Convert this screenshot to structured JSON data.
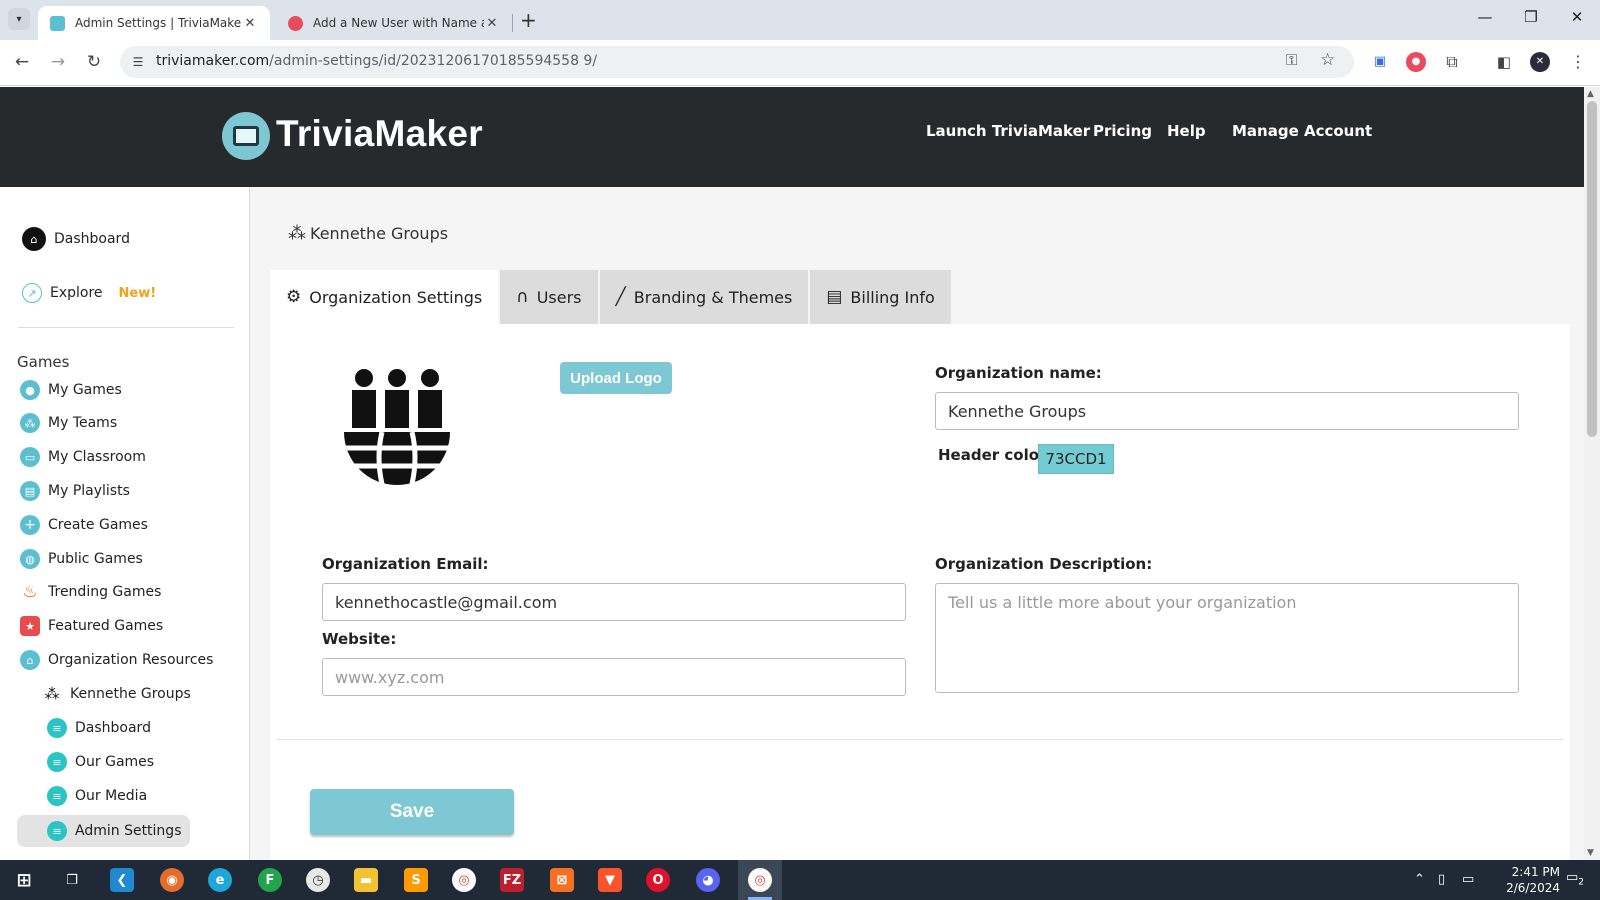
{
  "browser": {
    "tabs": [
      {
        "title": "Admin Settings | TriviaMaker - C",
        "active": true
      },
      {
        "title": "Add a New User with Name and",
        "active": false
      }
    ],
    "new_tab": "+",
    "address_host": "triviamaker.com",
    "address_path": "/admin-settings/id/20231206170185594558 9/",
    "window_controls": {
      "minimize": "—",
      "restore": "❐",
      "close": "✕"
    }
  },
  "site": {
    "logo_text": "TriviaMaker",
    "nav": [
      "Launch TriviaMaker",
      "Pricing",
      "Help",
      "Manage Account"
    ]
  },
  "sidebar": {
    "top_items": [
      {
        "label": "Dashboard",
        "icon": "home-icon"
      },
      {
        "label": "Explore",
        "icon": "compass-icon",
        "badge": "New!"
      }
    ],
    "section_title": "Games",
    "game_items": [
      {
        "label": "My Games",
        "icon": "user-icon",
        "color": "#5bbfcf"
      },
      {
        "label": "My Teams",
        "icon": "team-icon",
        "color": "#5bbfcf"
      },
      {
        "label": "My Classroom",
        "icon": "monitor-icon",
        "color": "#5bbfcf"
      },
      {
        "label": "My Playlists",
        "icon": "playlist-icon",
        "color": "#5bbfcf"
      },
      {
        "label": "Create Games",
        "icon": "plus-icon",
        "color": "#5bbfcf"
      },
      {
        "label": "Public Games",
        "icon": "globe-icon",
        "color": "#5bbfcf"
      },
      {
        "label": "Trending Games",
        "icon": "fire-icon",
        "color": "#e8622c"
      },
      {
        "label": "Featured Games",
        "icon": "star-icon",
        "color": "#e74c4c"
      },
      {
        "label": "Organization Resources",
        "icon": "bank-icon",
        "color": "#5bbfcf"
      }
    ],
    "org_items": [
      {
        "label": "Kennethe Groups",
        "icon": "org-group-icon"
      },
      {
        "label": "Dashboard",
        "icon": "list-icon"
      },
      {
        "label": "Our Games",
        "icon": "list-icon"
      },
      {
        "label": "Our Media",
        "icon": "list-icon"
      },
      {
        "label": "Admin Settings",
        "icon": "list-icon",
        "active": true
      }
    ]
  },
  "main": {
    "breadcrumb": "Kennethe Groups",
    "tabs": [
      {
        "label": "Organization Settings",
        "icon": "gear-icon",
        "active": true
      },
      {
        "label": "Users",
        "icon": "headset-icon"
      },
      {
        "label": "Branding & Themes",
        "icon": "pen-icon"
      },
      {
        "label": "Billing Info",
        "icon": "receipt-icon"
      }
    ],
    "upload_logo": "Upload Logo",
    "org_name_label": "Organization name:",
    "org_name_value": "Kennethe Groups",
    "header_color_label": "Header color:",
    "header_color_value": "73CCD1",
    "header_color_hex": "#73CCD1",
    "email_label": "Organization Email:",
    "email_value": "kennethocastle@gmail.com",
    "website_label": "Website:",
    "website_placeholder": "www.xyz.com",
    "description_label": "Organization Description:",
    "description_placeholder": "Tell us a little more about your organization",
    "save_label": "Save"
  },
  "taskbar": {
    "time": "2:41 PM",
    "date": "2/6/2024",
    "notifications": "2"
  },
  "colors": {
    "accent": "#7dc8d2",
    "header_bg": "#262a2d",
    "new_badge": "#f0a21b"
  }
}
